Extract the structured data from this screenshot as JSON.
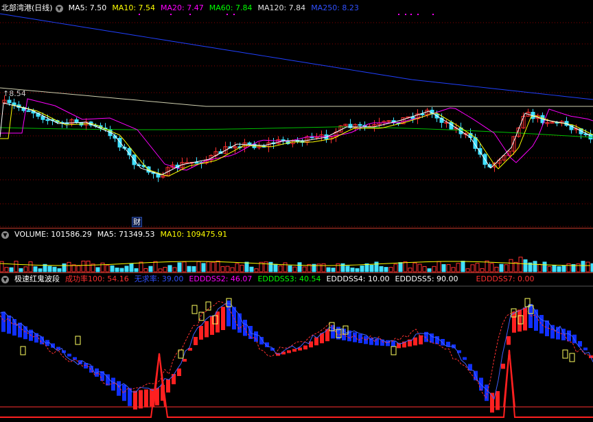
{
  "main": {
    "title": "北部湾港(日线)",
    "indicators": [
      {
        "label": "MA5: 7.50",
        "color": "#ffffff"
      },
      {
        "label": "MA10: 7.54",
        "color": "#ffff00"
      },
      {
        "label": "MA20: 7.47",
        "color": "#ff00ff"
      },
      {
        "label": "MA60: 7.84",
        "color": "#00ff00"
      },
      {
        "label": "MA120: 7.84",
        "color": "#e0e0e0"
      },
      {
        "label": "MA250: 8.23",
        "color": "#3050ff"
      }
    ],
    "high_label": "8.54",
    "finance_label": "财"
  },
  "volume": {
    "indicators": [
      {
        "label": "VOLUME: 101586.29",
        "color": "#ffffff"
      },
      {
        "label": "MA5: 71349.53",
        "color": "#ffffff"
      },
      {
        "label": "MA10: 109475.91",
        "color": "#ffff00"
      }
    ]
  },
  "osc": {
    "title": "极速红鬼波段",
    "indicators": [
      {
        "label": "成功率100: 54.16",
        "color": "#ff3030"
      },
      {
        "label": "无求率: 39.00",
        "color": "#3050ff"
      },
      {
        "label": "EDDDSS2: 46.07",
        "color": "#ff00ff"
      },
      {
        "label": "EDDDSS3: 40.54",
        "color": "#00ff00"
      },
      {
        "label": "EDDDSS4: 10.00",
        "color": "#ffffff"
      },
      {
        "label": "EDDDSS5: 90.00",
        "color": "#ffffff"
      },
      {
        "label": "EDDDSS7: 0.00",
        "color": "#ff3030"
      }
    ]
  },
  "colors": {
    "up": "#ff3030",
    "down": "#40e0ff",
    "bg": "#000000",
    "grid": "#800000"
  }
}
